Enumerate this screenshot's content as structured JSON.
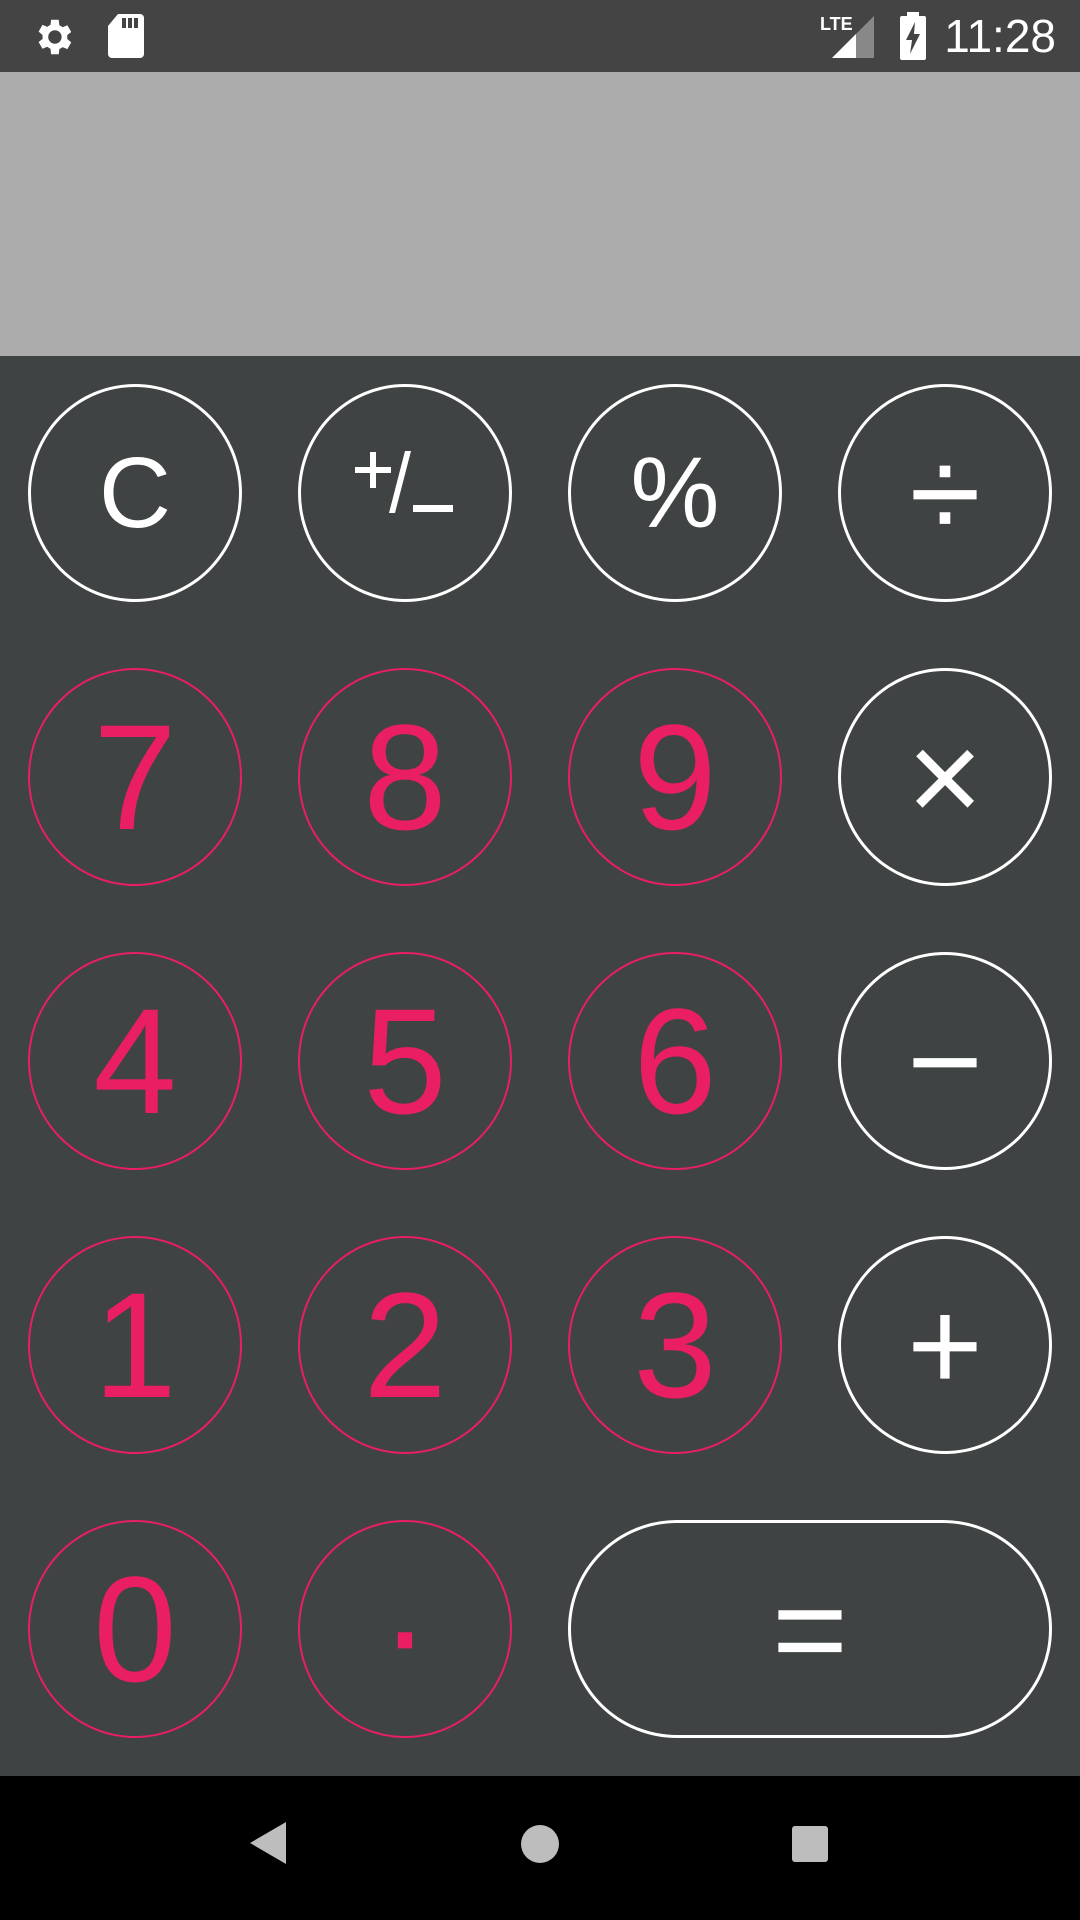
{
  "status_bar": {
    "left_icons": [
      "settings-gear-icon",
      "sd-card-icon"
    ],
    "network": "LTE",
    "battery": "charging",
    "time": "11:28"
  },
  "display": {
    "value": ""
  },
  "keys": {
    "clear": "C",
    "plus_minus": "+/−",
    "percent": "%",
    "divide": "÷",
    "seven": "7",
    "eight": "8",
    "nine": "9",
    "multiply": "×",
    "four": "4",
    "five": "5",
    "six": "6",
    "minus": "−",
    "one": "1",
    "two": "2",
    "three": "3",
    "plus": "+",
    "zero": "0",
    "decimal": "·",
    "equals": "="
  },
  "navigation": {
    "buttons": [
      "back-icon",
      "home-icon",
      "recents-icon"
    ]
  },
  "colors": {
    "status_bar": "#444444",
    "display_bg": "#acacac",
    "keypad_bg": "#404343",
    "digit_accent": "#e91e63",
    "operator": "#ffffff",
    "nav_bar": "#000000"
  }
}
